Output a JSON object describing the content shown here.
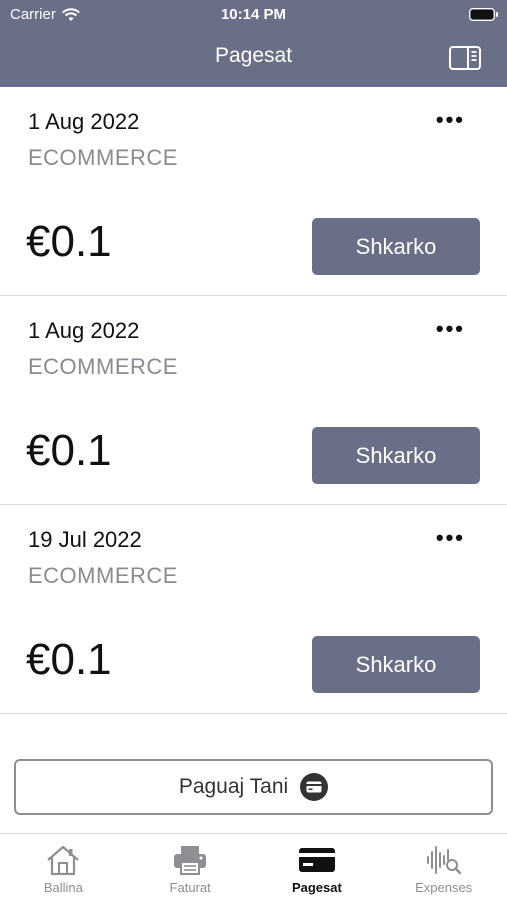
{
  "status_bar": {
    "carrier": "Carrier",
    "time": "10:14 PM"
  },
  "nav": {
    "title": "Pagesat",
    "sidebar_icon": "sidebar-toggle-icon"
  },
  "payments": [
    {
      "date": "1 Aug 2022",
      "type": "ECOMMERCE",
      "amount": "€0.1",
      "action_label": "Shkarko"
    },
    {
      "date": "1 Aug 2022",
      "type": "ECOMMERCE",
      "amount": "€0.1",
      "action_label": "Shkarko"
    },
    {
      "date": "19 Jul 2022",
      "type": "ECOMMERCE",
      "amount": "€0.1",
      "action_label": "Shkarko"
    }
  ],
  "pay_button": {
    "label": "Paguaj Tani",
    "icon": "credit-card-icon"
  },
  "tabs": [
    {
      "label": "Ballina",
      "icon": "home-icon",
      "active": false
    },
    {
      "label": "Faturat",
      "icon": "printer-icon",
      "active": false
    },
    {
      "label": "Pagesat",
      "icon": "credit-card-icon",
      "active": true
    },
    {
      "label": "Expenses",
      "icon": "waveform-search-icon",
      "active": false
    }
  ],
  "colors": {
    "accent": "#6a6f88",
    "secondary_text": "#8b8b8f",
    "tab_inactive": "#8e8e93"
  }
}
